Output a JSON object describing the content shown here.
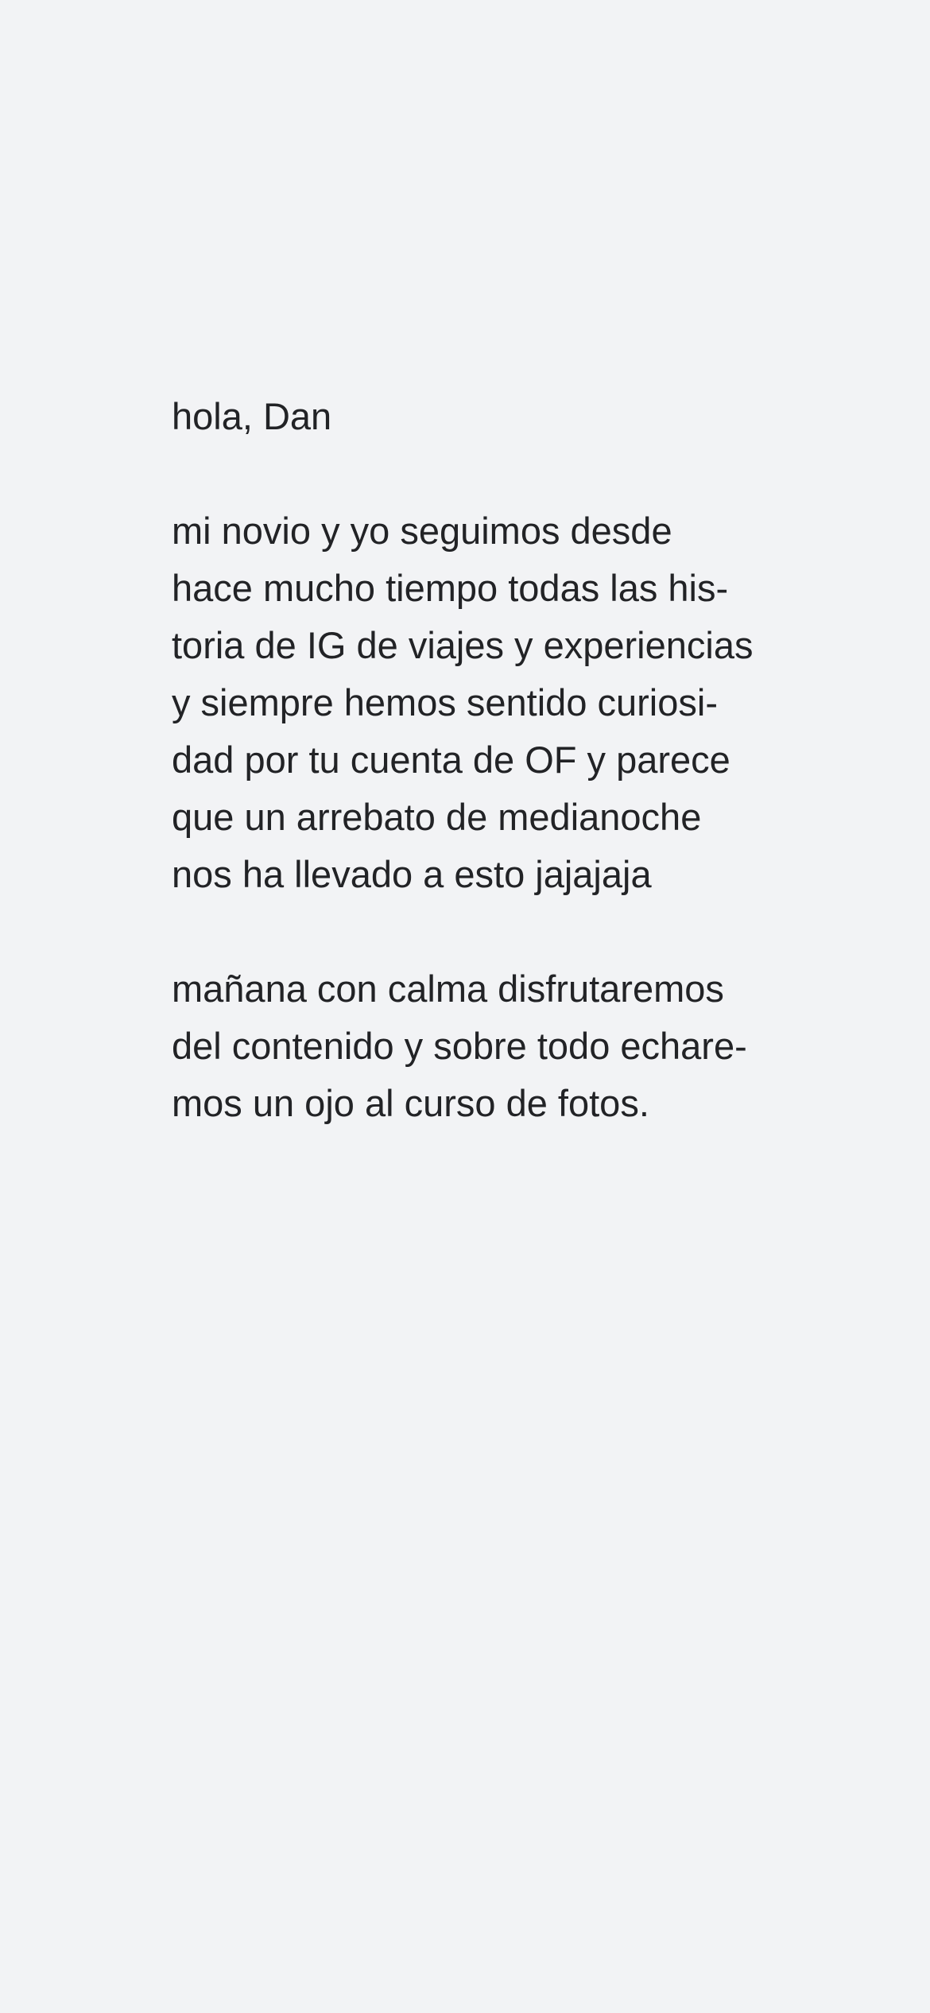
{
  "note": {
    "greeting": "hola, Dan",
    "paragraph1": [
      "mi novio y yo seguimos desde",
      "hace mucho tiempo todas las his-",
      "toria de IG de viajes y experiencias",
      "y siempre hemos sentido curiosi-",
      "dad por tu cuenta de OF y parece",
      "que un arrebato de medianoche",
      "nos ha llevado a esto jajajaja"
    ],
    "paragraph2": [
      "mañana con calma disfrutaremos",
      "del contenido y sobre todo echare-",
      "mos un ojo al curso de fotos."
    ]
  }
}
